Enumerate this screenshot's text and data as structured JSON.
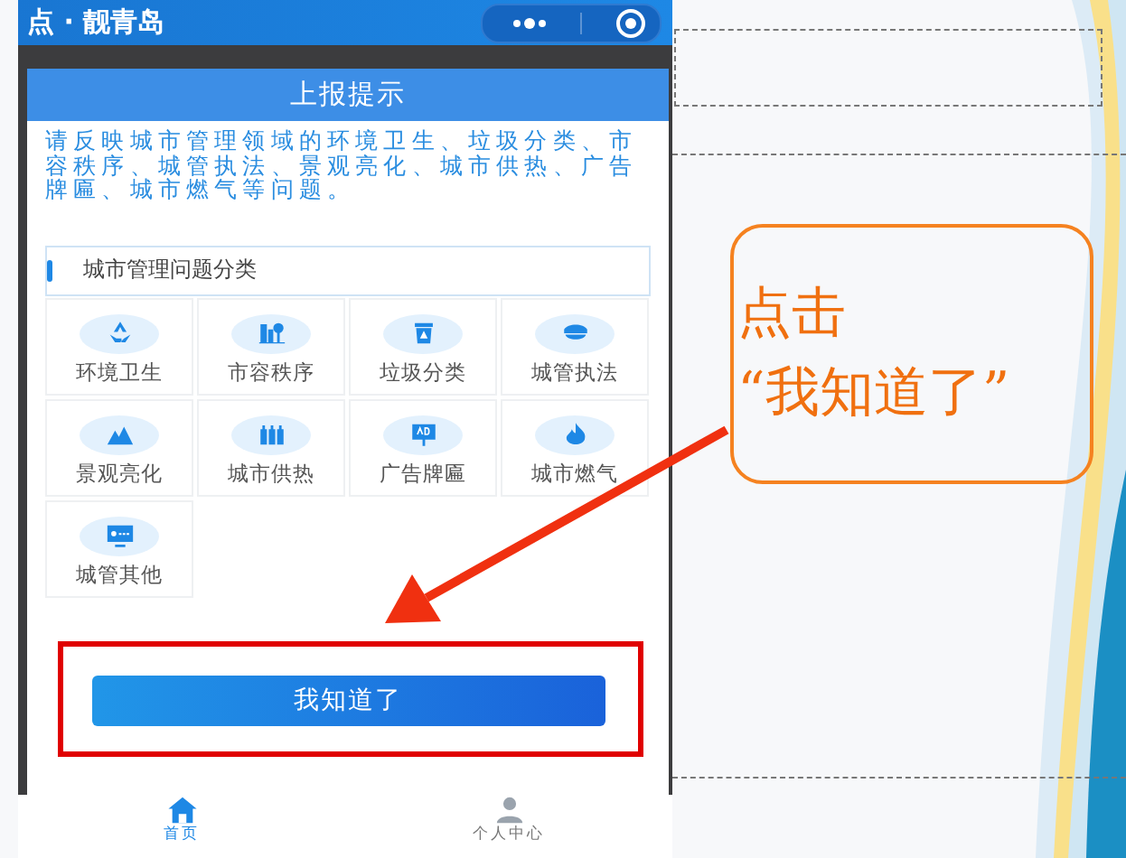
{
  "app_bar": {
    "title": "点 · 靓青岛"
  },
  "dialog": {
    "title": "上报提示",
    "message": "请反映城市管理领域的环境卫生、垃圾分类、市容秩序、城管执法、景观亮化、城市供热、广告牌匾、城市燃气等问题。",
    "section_title": "城市管理问题分类",
    "categories": [
      {
        "label": "环境卫生",
        "kind": "recycle"
      },
      {
        "label": "市容秩序",
        "kind": "buildings"
      },
      {
        "label": "垃圾分类",
        "kind": "bin"
      },
      {
        "label": "城管执法",
        "kind": "cap"
      },
      {
        "label": "景观亮化",
        "kind": "mountain"
      },
      {
        "label": "城市供热",
        "kind": "cylinders"
      },
      {
        "label": "广告牌匾",
        "kind": "billboard"
      },
      {
        "label": "城市燃气",
        "kind": "flame"
      },
      {
        "label": "城管其他",
        "kind": "monitor"
      }
    ],
    "confirm_button": "我知道了"
  },
  "tab_bar": [
    {
      "label": "首页",
      "kind": "home",
      "selected": true
    },
    {
      "label": "个人中心",
      "kind": "person",
      "selected": false
    }
  ],
  "annotation": {
    "lines": [
      "点击",
      "“我知道了”"
    ]
  }
}
